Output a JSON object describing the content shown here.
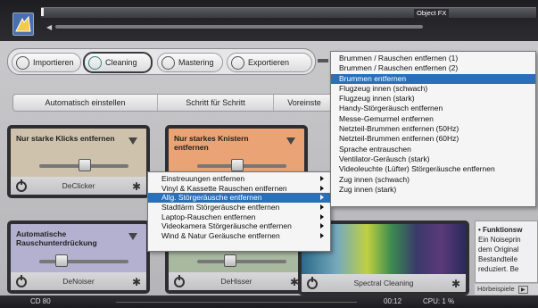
{
  "topbar": {
    "object_fx": "Object FX"
  },
  "tabs": [
    {
      "label": "Importieren"
    },
    {
      "label": "Cleaning"
    },
    {
      "label": "Mastering"
    },
    {
      "label": "Exportieren"
    }
  ],
  "modes": [
    {
      "label": "Automatisch einstellen"
    },
    {
      "label": "Schritt für Schritt"
    },
    {
      "label": "Voreinste"
    }
  ],
  "cards": [
    {
      "title": "Nur starke Klicks entfernen",
      "name": "DeClicker",
      "color": "#cfc2ad"
    },
    {
      "title": "Nur starkes Knistern entfernen",
      "name": "",
      "color": "#e9a374"
    },
    {
      "title": "Automatische Rauschunterdrückung",
      "name": "DeNoiser",
      "color": "#b4b0d0"
    },
    {
      "title": "",
      "name": "DeHisser",
      "color": "#a9b9a0"
    }
  ],
  "spectral": {
    "name": "Spectral Cleaning"
  },
  "info": {
    "title": "• Funktionsw",
    "lines": [
      "Ein Noiseprin",
      "dem Original",
      "Bestandteile",
      "reduziert. Be"
    ],
    "hoer": "Hörbeispiele"
  },
  "status": {
    "cd": "CD 80",
    "time": "00:12",
    "cpu": "CPU: 1 %"
  },
  "context_menu": {
    "items": [
      {
        "label": "Einstreuungen entfernen",
        "highlighted": false
      },
      {
        "label": "Vinyl & Kassette Rauschen entfernen",
        "highlighted": false
      },
      {
        "label": "Allg. Störgeräusche entfernen",
        "highlighted": true
      },
      {
        "label": "Stadtlärm Störgeräusche entfernen",
        "highlighted": false
      },
      {
        "label": "Laptop-Rauschen entfernen",
        "highlighted": false
      },
      {
        "label": "Videokamera Störgeräusche entfernen",
        "highlighted": false
      },
      {
        "label": "Wind & Natur Geräusche entfernen",
        "highlighted": false
      }
    ]
  },
  "submenu": {
    "items": [
      {
        "label": "Brummen / Rauschen entfernen (1)",
        "highlighted": false
      },
      {
        "label": "Brummen / Rauschen entfernen (2)",
        "highlighted": false
      },
      {
        "label": "Brummen entfernen",
        "highlighted": true
      },
      {
        "label": "Flugzeug innen (schwach)",
        "highlighted": false
      },
      {
        "label": "Flugzeug innen (stark)",
        "highlighted": false
      },
      {
        "label": "Handy-Störgeräusch entfernen",
        "highlighted": false
      },
      {
        "label": "Messe-Gemurmel entfernen",
        "highlighted": false
      },
      {
        "label": "Netzteil-Brummen entfernen (50Hz)",
        "highlighted": false
      },
      {
        "label": "Netzteil-Brummen entfernen (60Hz)",
        "highlighted": false
      },
      {
        "label": "Sprache entrauschen",
        "highlighted": false
      },
      {
        "label": "Ventilator-Geräusch (stark)",
        "highlighted": false
      },
      {
        "label": "Videoleuchte (Lüfter) Störgeräusche entfernen",
        "highlighted": false
      },
      {
        "label": "Zug innen (schwach)",
        "highlighted": false
      },
      {
        "label": "Zug innen (stark)",
        "highlighted": false
      }
    ]
  },
  "colors": {
    "highlight": "#2a6fb8",
    "cleaning_accent": "#2f8a7a"
  }
}
